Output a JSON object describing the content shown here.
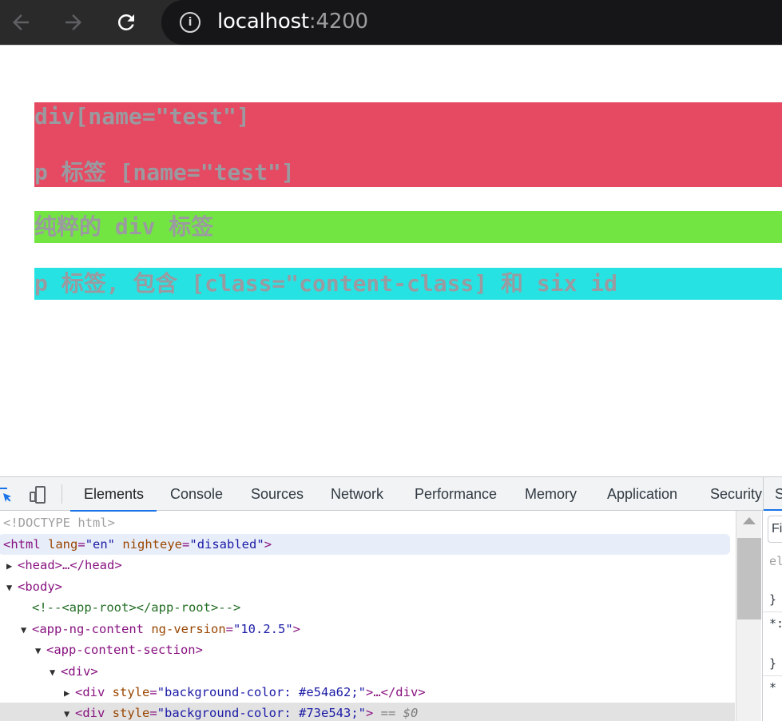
{
  "browser": {
    "url_host": "localhost",
    "url_port": ":4200",
    "icons": [
      "back-arrow-icon",
      "forward-arrow-icon",
      "reload-icon",
      "info-icon"
    ]
  },
  "page": {
    "blocks": [
      {
        "lines": [
          "div[name=\"test\"]",
          "p 标签 [name=\"test\"]"
        ],
        "bg": "#e54a62"
      },
      {
        "lines": [
          "纯粹的 div 标签"
        ],
        "bg": "#73e543"
      },
      {
        "lines": [
          "p 标签, 包含 [class=\"content-class] 和 six id"
        ],
        "bg": "#27e2e2"
      }
    ]
  },
  "devtools": {
    "tabs": [
      "Elements",
      "Console",
      "Sources",
      "Network",
      "Performance",
      "Memory",
      "Application",
      "Security"
    ],
    "active_tab": "Elements",
    "side_letters": [
      "S",
      "Fi",
      "el",
      "}",
      "*:",
      "}",
      "*"
    ],
    "dom": {
      "doctype": "<!DOCTYPE html>",
      "html_tag": "html",
      "html_attr1_name": "lang",
      "html_attr1_val": "\"en\"",
      "html_attr2_name": "nighteye",
      "html_attr2_val": "\"disabled\"",
      "head_collapsed": "<head>…</head>",
      "body_open": "<body>",
      "comment": "<!--<app-root></app-root>-->",
      "app_ng_content": "app-ng-content",
      "ng_version_name": "ng-version",
      "ng_version_val": "\"10.2.5\"",
      "app_content_section": "<app-content-section>",
      "div_open": "<div>",
      "style_attr": "style",
      "style_val_red": "\"background-color: #e54a62;\"",
      "style_val_green": "\"background-color: #73e543;\"",
      "collapsed_suffix": ">…</div>",
      "selected_marker": "== $0"
    }
  }
}
